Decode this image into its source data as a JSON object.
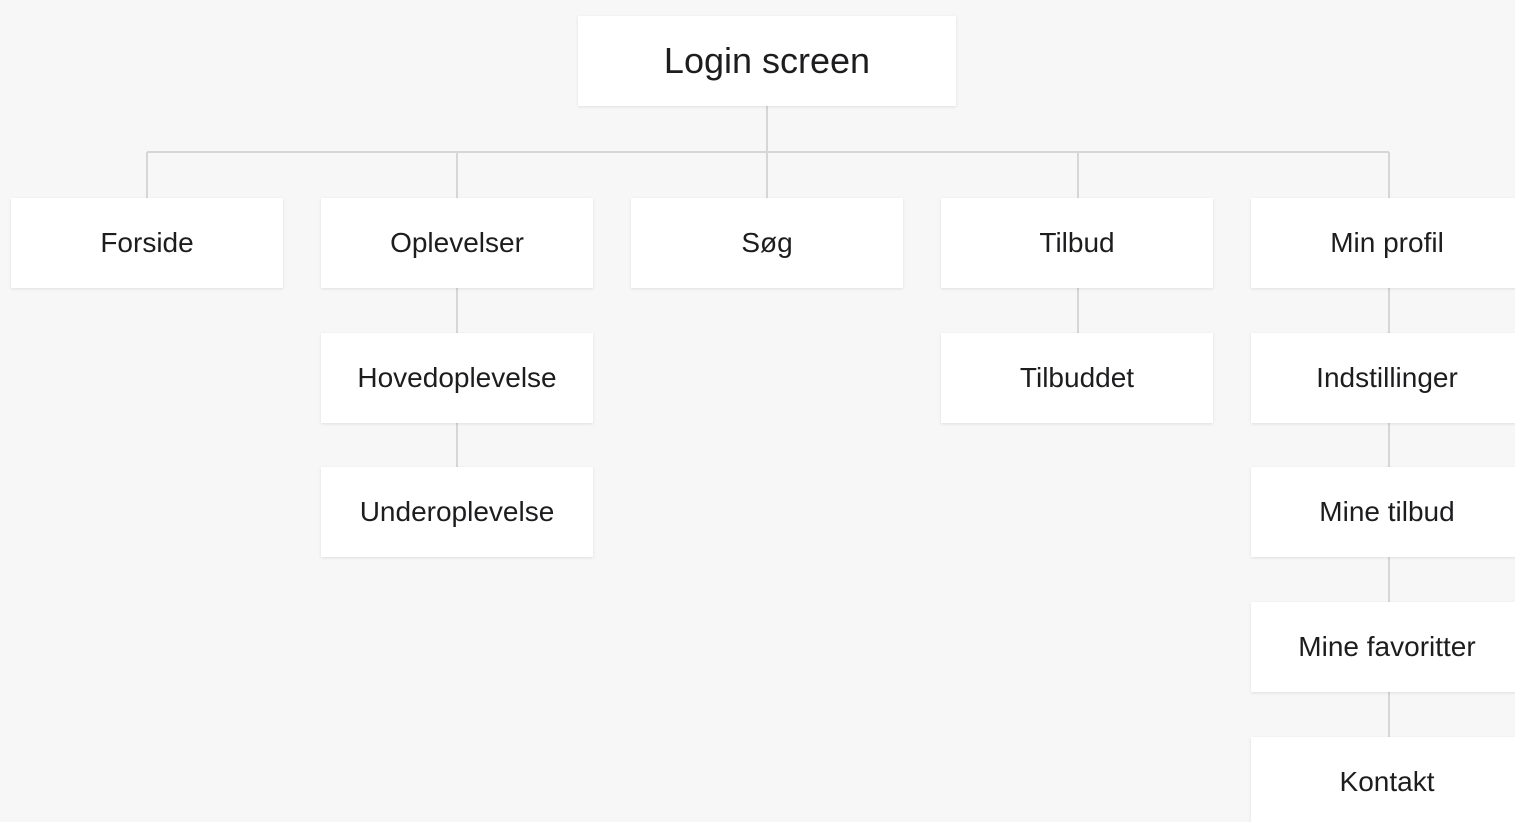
{
  "diagram": {
    "root": {
      "label": "Login screen"
    },
    "level1": [
      {
        "label": "Forside"
      },
      {
        "label": "Oplevelser"
      },
      {
        "label": "Søg"
      },
      {
        "label": "Tilbud"
      },
      {
        "label": "Min profil"
      }
    ],
    "oplevelser_children": [
      {
        "label": "Hovedoplevelse"
      },
      {
        "label": "Underoplevelse"
      }
    ],
    "tilbud_children": [
      {
        "label": "Tilbuddet"
      }
    ],
    "minprofil_children": [
      {
        "label": "Indstillinger"
      },
      {
        "label": "Mine tilbud"
      },
      {
        "label": "Mine favoritter"
      },
      {
        "label": "Kontakt"
      }
    ],
    "colors": {
      "background": "#f7f7f7",
      "node_fill": "#ffffff",
      "connector": "#d6d6d6",
      "text": "#1d1d1f"
    }
  }
}
